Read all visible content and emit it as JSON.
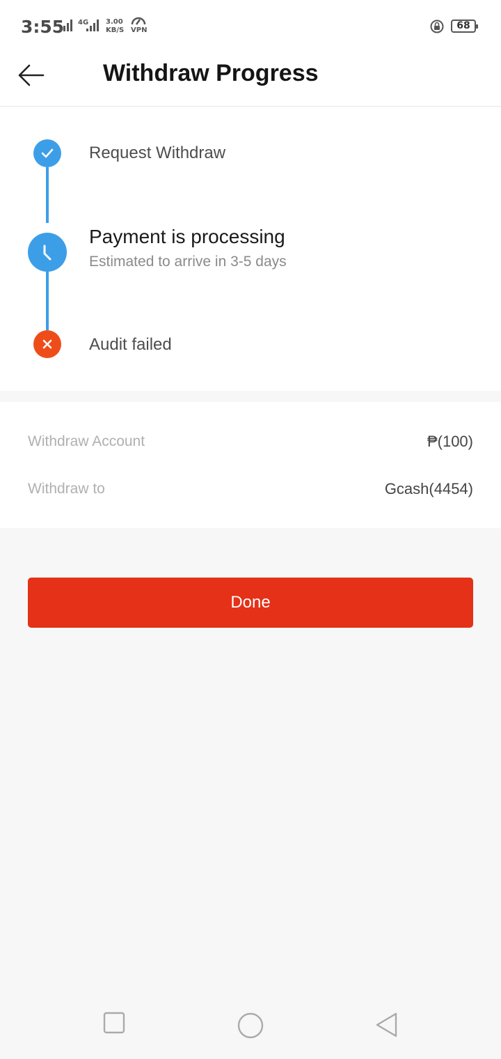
{
  "status_bar": {
    "time": "3:55",
    "network_tag": "4G",
    "speed_value": "3.00",
    "speed_unit": "KB/S",
    "vpn": "VPN",
    "battery": "68"
  },
  "header": {
    "title": "Withdraw Progress"
  },
  "steps": [
    {
      "label": "Request Withdraw",
      "status": "done",
      "icon": "check-icon"
    },
    {
      "label": "Payment is processing",
      "sub": "Estimated to arrive in 3-5 days",
      "status": "current",
      "icon": "clock-icon"
    },
    {
      "label": "Audit failed",
      "status": "failed",
      "icon": "x-icon"
    }
  ],
  "details": {
    "account_label": "Withdraw Account",
    "account_value": "₱(100)",
    "to_label": "Withdraw to",
    "to_value": "Gcash(4454)"
  },
  "done_label": "Done",
  "colors": {
    "accent_blue": "#3d9ee8",
    "fail_orange": "#ee4d1a",
    "button_red": "#e43117"
  }
}
